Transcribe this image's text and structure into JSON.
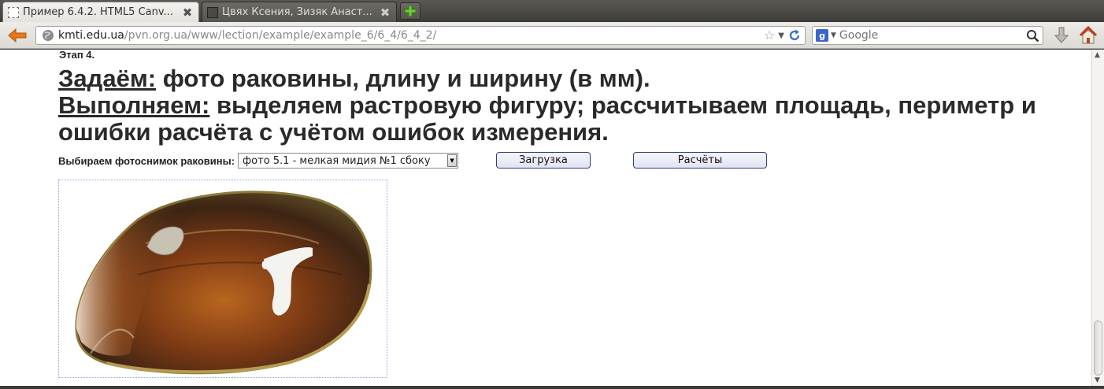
{
  "tabs": [
    {
      "title": "Пример 6.4.2. HTML5 Canv...",
      "active": true
    },
    {
      "title": "Цвях Ксения, Зизяк Анаст...",
      "active": false
    }
  ],
  "toolbar": {
    "url_host": "kmti.edu.ua",
    "url_path": "/pvn.org.ua/www/lection/example/example_6/6_4/6_4_2/",
    "search_placeholder": "Google",
    "search_engine_badge": "g"
  },
  "page": {
    "stage_label": "Этап 4.",
    "line1_key": "Задаём:",
    "line1_rest": " фото раковины, длину и ширину (в мм).",
    "line2_key": "Выполняем:",
    "line2_rest": " выделяем растровую фигуру; рассчитываем площадь, периметр и ошибки расчёта с учётом ошибок измерения.",
    "select_label": "Выбираем фотоснимок раковины:",
    "select_value": "фото 5.1 - мелкая мидия №1 сбоку",
    "load_button": "Загрузка",
    "calc_button": "Расчёты"
  },
  "icons": {
    "back": "back-arrow-icon",
    "bookmark": "star-icon",
    "reload": "reload-icon",
    "search": "magnifier-icon",
    "download": "download-arrow-icon",
    "home": "home-icon",
    "new_tab": "plus-icon"
  },
  "colors": {
    "accent_orange": "#e8761a",
    "button_border": "#2d3f86",
    "heading_text": "#2a2a2a"
  }
}
